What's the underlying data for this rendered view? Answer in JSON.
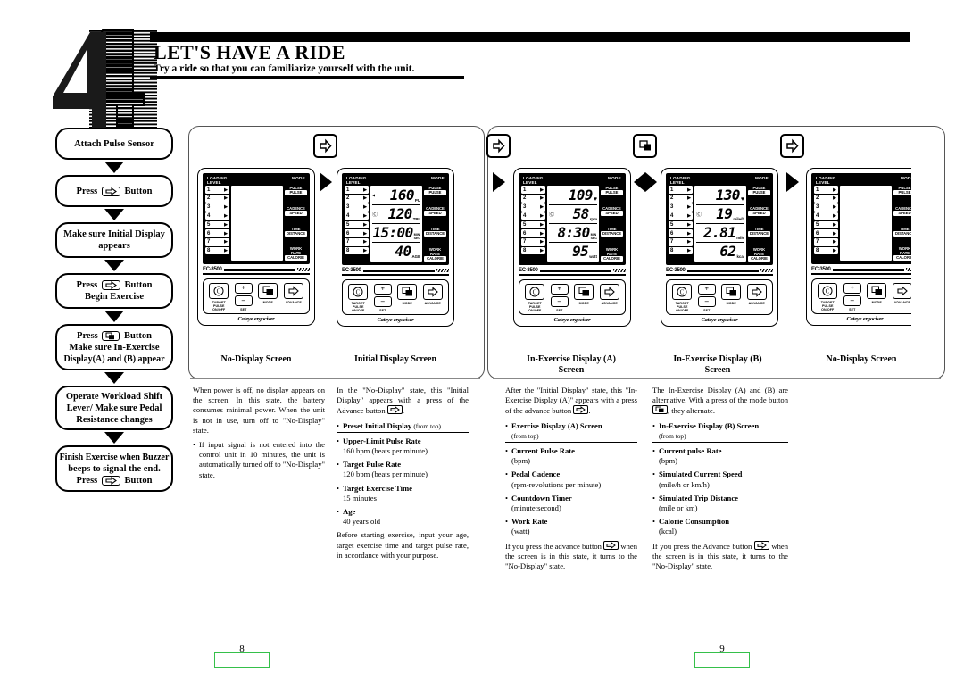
{
  "header": {
    "step_number": "4",
    "title": "LET'S HAVE A RIDE",
    "subtitle": "Try a ride so that you can familiarize yourself with the unit."
  },
  "flow": {
    "steps": [
      {
        "lines": [
          "Attach Pulse Sensor"
        ],
        "icon": null
      },
      {
        "lines": [
          "Press |ADVANCE| Button"
        ],
        "icon": "advance-icon"
      },
      {
        "lines": [
          "Make sure Initial Display",
          "appears"
        ],
        "icon": null
      },
      {
        "lines": [
          "Press |ADVANCE| Button",
          "Begin Exercise"
        ],
        "icon": "advance-icon"
      },
      {
        "lines": [
          "Press |MODE| Button",
          "Make sure In-Exercise",
          "Display(A) and (B) appear"
        ],
        "icon": "mode-icon"
      },
      {
        "lines": [
          "Operate Workload Shift",
          "Lever/ Make sure Pedal",
          "Resistance changes"
        ],
        "icon": null
      },
      {
        "lines": [
          "Finish Exercise when Buzzer",
          "beeps to signal the end.",
          "Press |ADVANCE| Button"
        ],
        "icon": "advance-icon"
      }
    ]
  },
  "console": {
    "loading_level_label": "LOADING\nLEVEL",
    "loading_label_l1": "LOADING",
    "loading_label_l2": "LEVEL",
    "mode_label": "MODE",
    "levels": [
      "1",
      "2",
      "3",
      "4",
      "5",
      "6",
      "7",
      "8"
    ],
    "mode_buttons": [
      {
        "top": "PULSE",
        "bottom": "PULSE"
      },
      {
        "top": "CADENCE",
        "bottom": "SPEED"
      },
      {
        "top": "TIME",
        "bottom": "DISTANCE"
      },
      {
        "top": "WORK RATE",
        "bottom": "CALORIE"
      }
    ],
    "model_no": "EC-3500",
    "brand": "Cateye ergociser",
    "buttons": [
      {
        "key": "target-pulse-icon",
        "label_lines": [
          "TARGET",
          "PULSE",
          "ON/OFF"
        ]
      },
      {
        "key": "set-plus-minus",
        "label_lines": [
          "SET"
        ],
        "plus": "+",
        "minus": "–"
      },
      {
        "key": "mode-icon",
        "label_lines": [
          "MODE"
        ]
      },
      {
        "key": "advance-icon",
        "label_lines": [
          "ADVANCE"
        ]
      }
    ]
  },
  "panels": [
    {
      "id": "no-display-left",
      "caption": "No-Display Screen",
      "readout": null
    },
    {
      "id": "initial-display",
      "caption": "Initial Display Screen",
      "readout": {
        "rows": [
          {
            "value": "160",
            "unit": "PU",
            "heart": false,
            "lmark": false
          },
          {
            "value": "120",
            "unit": "TPL",
            "heart": false,
            "lmark": true
          },
          {
            "value": "15:00",
            "unit": "MIN\nSEC",
            "heart": false,
            "lmark": false
          },
          {
            "value": "40",
            "unit": "AGE",
            "heart": false,
            "lmark": false
          }
        ]
      }
    },
    {
      "id": "in-exercise-a",
      "caption": "In-Exercise Display (A)\nScreen",
      "caption_l1": "In-Exercise Display (A)",
      "caption_l2": "Screen",
      "readout": {
        "rows": [
          {
            "value": "109",
            "unit": "",
            "heart": true,
            "lmark": false
          },
          {
            "value": "58",
            "unit": "rpm",
            "heart": false,
            "lmark": true
          },
          {
            "value": "8:30",
            "unit": "MIN\nSEC",
            "heart": false,
            "lmark": false
          },
          {
            "value": "95",
            "unit": "watt",
            "heart": false,
            "lmark": false
          }
        ]
      }
    },
    {
      "id": "in-exercise-b",
      "caption": "In-Exercise Display (B)\nScreen",
      "caption_l1": "In-Exercise Display (B)",
      "caption_l2": "Screen",
      "readout": {
        "rows": [
          {
            "value": "130",
            "unit": "",
            "heart": true,
            "lmark": false
          },
          {
            "value": "19",
            "unit": "mile/h",
            "heart": false,
            "lmark": true
          },
          {
            "value": "2.81",
            "unit": "mile",
            "heart": false,
            "lmark": false
          },
          {
            "value": "62",
            "unit": "kcal",
            "heart": false,
            "lmark": false
          }
        ]
      }
    },
    {
      "id": "no-display-right",
      "caption": "No-Display Screen",
      "readout": null
    }
  ],
  "columns": [
    {
      "id": "col-no-display",
      "intro": "When power is off, no display appears on the screen. In this state, the battery consumes minimal power. When the unit is not in use, turn off to \"No-Display\" state.",
      "bullets": [
        {
          "text": "If input signal is not entered into the control unit in 10 minutes, the unit is automatically turned off to \"No-Display\" state."
        }
      ],
      "outro": ""
    },
    {
      "id": "col-initial-display",
      "intro_a": "In the \"No-Display\" state, this \"Initial Display\" appears with a press of the Advance button",
      "intro_b": ".",
      "heading": "Preset Initial Display",
      "heading_note": "(from top)",
      "items": [
        {
          "title": "Upper-Limit Pulse Rate",
          "detail": "160 bpm (beats per minute)"
        },
        {
          "title": "Target Pulse Rate",
          "detail": "120 bpm (beats per minute)"
        },
        {
          "title": "Target Exercise Time",
          "detail": "15 minutes"
        },
        {
          "title": "Age",
          "detail": "40 years old"
        }
      ],
      "outro": "Before starting exercise, input your age, target exercise time and target pulse rate, in accordance with your purpose."
    },
    {
      "id": "col-in-exercise-a",
      "intro_a": "After the \"Initial Display\" state, this \"In-Exercise Display (A)\" appears with a press of the advance button",
      "intro_b": ".",
      "heading": "Exercise Display (A) Screen",
      "heading_note": "(from top)",
      "items": [
        {
          "title": "Current Pulse Rate",
          "detail": "(bpm)"
        },
        {
          "title": "Pedal Cadence",
          "detail": "(rpm-revolutions per minute)"
        },
        {
          "title": "Countdown Timer",
          "detail": "(minute:second)"
        },
        {
          "title": "Work Rate",
          "detail": "(watt)"
        }
      ],
      "outro_a": "If you press the advance button",
      "outro_b": "when the screen is in this state, it turns to the \"No-Display\" state."
    },
    {
      "id": "col-in-exercise-b",
      "intro_a": "The In-Exercise Display (A) and (B) are alternative. With a press of the mode button",
      "intro_b": ", they alternate.",
      "heading": "In-Exercise Display (B) Screen",
      "heading_note": "(from top)",
      "items": [
        {
          "title": "Current pulse Rate",
          "detail": "(bpm)"
        },
        {
          "title": "Simulated Current Speed",
          "detail": "(mile/h or km/h)"
        },
        {
          "title": "Simulated Trip Distance",
          "detail": "(mile or km)"
        },
        {
          "title": "Calorie Consumption",
          "detail": "(kcal)"
        }
      ],
      "outro_a": "If you press the Advance button",
      "outro_b": "when the screen is in this state, it turns to the \"No-Display\" state."
    }
  ],
  "page_numbers": {
    "left": "8",
    "right": "9"
  },
  "colors": {
    "page_number_border": "#35c04a",
    "ink": "#000000"
  }
}
